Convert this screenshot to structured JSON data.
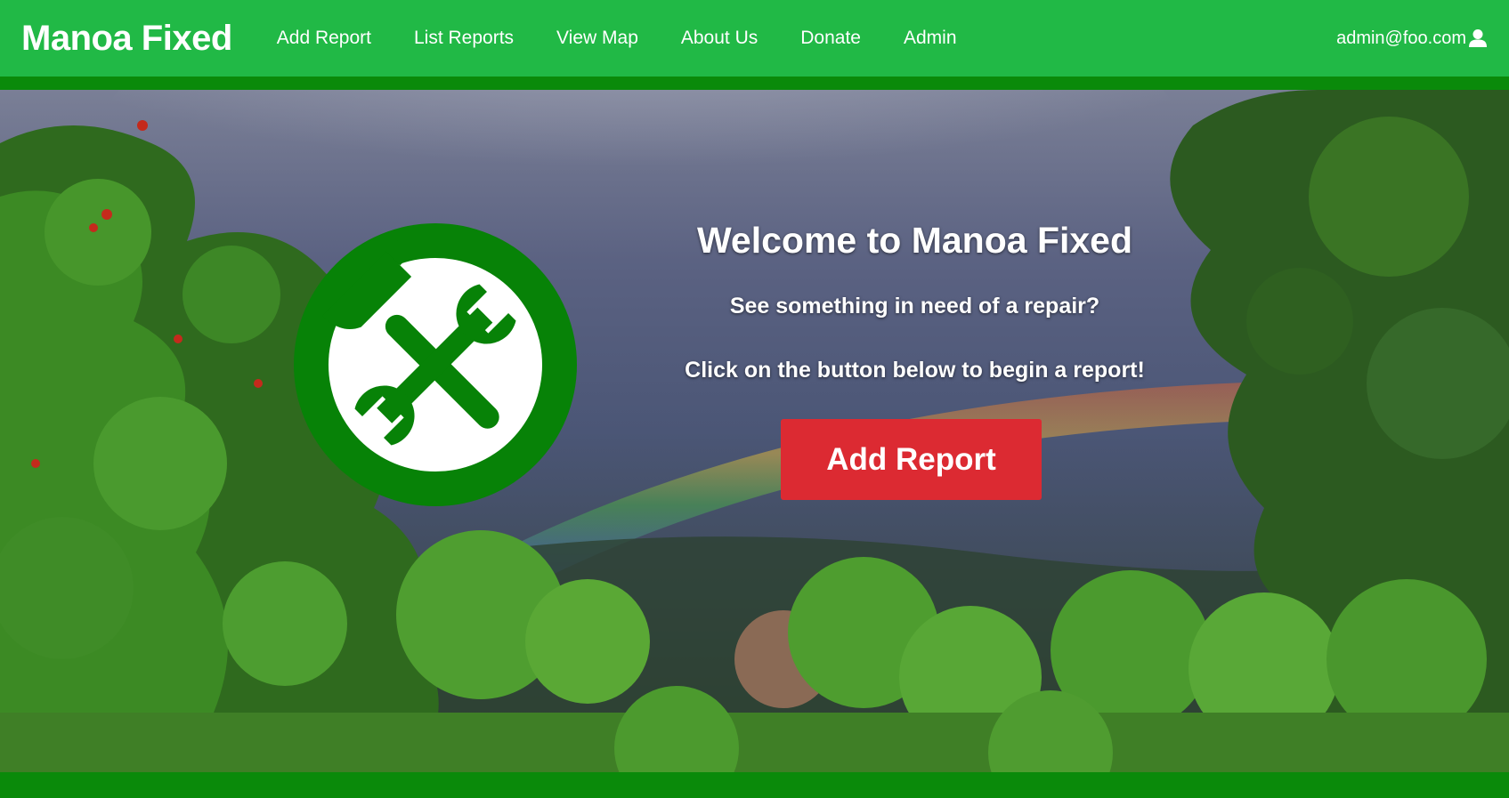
{
  "navbar": {
    "brand": "Manoa Fixed",
    "items": [
      {
        "label": "Add Report"
      },
      {
        "label": "List Reports"
      },
      {
        "label": "View Map"
      },
      {
        "label": "About Us"
      },
      {
        "label": "Donate"
      },
      {
        "label": "Admin"
      }
    ],
    "user_email": "admin@foo.com",
    "user_icon": "user-icon"
  },
  "hero": {
    "title": "Welcome to Manoa Fixed",
    "subtitle": "See something in need of a repair?",
    "instruction": "Click on the button below to begin a report!",
    "button_label": "Add Report",
    "logo_icon": "tools-icon"
  },
  "colors": {
    "nav_green": "#21b946",
    "dark_green": "#0a8a0a",
    "logo_green": "#078207",
    "button_red": "#dc2a32",
    "white": "#ffffff"
  }
}
